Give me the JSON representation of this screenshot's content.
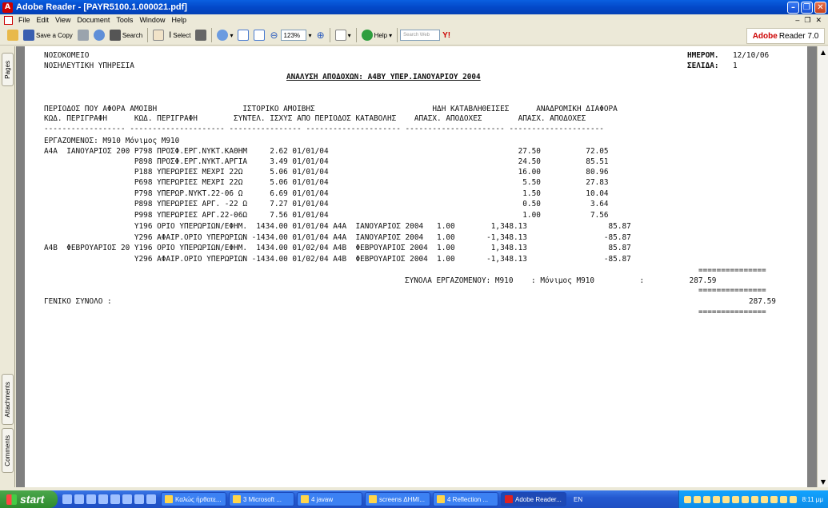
{
  "window": {
    "title": "Adobe Reader - [PAYR5100.1.000021.pdf]"
  },
  "menu": [
    "File",
    "Edit",
    "View",
    "Document",
    "Tools",
    "Window",
    "Help"
  ],
  "toolbar": {
    "save_copy": "Save a Copy",
    "search": "Search",
    "select": "Select",
    "zoom": "123%",
    "help": "Help",
    "search_web_placeholder": "Search Web",
    "brand": "Adobe",
    "brand_product": "Reader 7.0"
  },
  "side_tabs": {
    "pages": "Pages",
    "attachments": "Attachments",
    "comments": "Comments"
  },
  "document": {
    "org1": "ΝΟΣΟΚΟΜΕΙΟ",
    "org2": "ΝΟΣΗΛΕΥΤΙΚΗ ΥΠΗΡΕΣΙΑ",
    "date_label": "ΗΜΕΡΟΜ.",
    "date_value": "12/10/06",
    "page_label": "ΣΕΛΙΔΑ:",
    "page_value": "1",
    "report_title": "ΑΝΑΛΥΣΗ ΑΠΟΔΟΧΩΝ: Α4ΒΥ ΥΠΕΡ.ΙΑΝΟΥΑΡΙΟΥ 2004",
    "header_row1": "ΠΕΡΙΟΔΟΣ ΠΟΥ ΑΦΟΡΑ ΑΜΟΙΒΗ                   ΙΣΤΟΡΙΚΟ ΑΜΟΙΒΗΣ                          ΗΔΗ ΚΑΤΑΒΛΗΘΕΙΣΕΣ      ΑΝΑΔΡΟΜΙΚΗ ΔΙΑΦΟΡΑ",
    "header_row2": "ΚΩΔ. ΠΕΡΙΓΡΑΦΗ      ΚΩΔ. ΠΕΡΙΓΡΑΦΗ        ΣΥΝΤΕΛ. ΙΣΧΥΣ ΑΠΟ ΠΕΡΙΟΔΟΣ ΚΑΤΑΒΟΛΗΣ    ΑΠΑΣΧ. ΑΠΟΔΟΧΕΣ        ΑΠΑΣΧ. ΑΠΟΔΟΧΕΣ",
    "dash_row": "------------------ --------------------- ---------------- --------------------- ---------------------- ---------------------",
    "employee_line": "ΕΡΓΑΖΟΜΕΝΟΣ: Μ910 Μόνιμος Μ910",
    "rows": [
      "Α4Α  ΙΑΝΟΥΑΡΙΟΣ 200 Ρ798 ΠΡΟΣΦ.ΕΡΓ.ΝΥΚΤ.ΚΑΘΗΜ     2.62 01/01/04                                          27.50          72.05",
      "                    Ρ898 ΠΡΟΣΦ.ΕΡΓ.ΝΥΚΤ.ΑΡΓΙΑ     3.49 01/01/04                                          24.50          85.51",
      "                    Ρ188 ΥΠΕΡΩΡΙΕΣ ΜΕΧΡΙ 22Ω      5.06 01/01/04                                          16.00          80.96",
      "                    Ρ698 ΥΠΕΡΩΡΙΕΣ ΜΕΧΡΙ 22Ω      5.06 01/01/04                                           5.50          27.83",
      "                    Ρ798 ΥΠΕΡΩΡ.ΝΥΚΤ.22-06 Ω      6.69 01/01/04                                           1.50          10.04",
      "                    Ρ898 ΥΠΕΡΩΡΙΕΣ ΑΡΓ. -22 Ω     7.27 01/01/04                                           0.50           3.64",
      "                    Ρ998 ΥΠΕΡΩΡΙΕΣ ΑΡΓ.22-06Ω     7.56 01/01/04                                           1.00           7.56",
      "                    Υ196 ΟΡΙΟ ΥΠΕΡΩΡΙΩΝ/ΕΦΗΜ.  1434.00 01/01/04 Α4Α  ΙΑΝΟΥΑΡΙΟΣ 2004   1.00        1,348.13                  85.87",
      "                    Υ296 ΑΦΑΙΡ.ΟΡΙΟ ΥΠΕΡΩΡΙΩΝ -1434.00 01/01/04 Α4Α  ΙΑΝΟΥΑΡΙΟΣ 2004   1.00       -1,348.13                 -85.87",
      "Α4Β  ΦΕΒΡΟΥΑΡΙΟΣ 20 Υ196 ΟΡΙΟ ΥΠΕΡΩΡΙΩΝ/ΕΦΗΜ.  1434.00 01/02/04 Α4Β  ΦΕΒΡΟΥΑΡΙΟΣ 2004  1.00        1,348.13                  85.87",
      "                    Υ296 ΑΦΑΙΡ.ΟΡΙΟ ΥΠΕΡΩΡΙΩΝ -1434.00 01/02/04 Α4Β  ΦΕΒΡΟΥΑΡΙΟΣ 2004  1.00       -1,348.13                 -85.87"
    ],
    "eq_line": "===============",
    "employee_total": "ΣΥΝΟΛΑ ΕΡΓΑΖΟΜΕΝΟΥ: Μ910    : Μόνιμος Μ910          :          287.59",
    "grand_total_label": "ΓΕΝΙΚΟ ΣΥΝΟΛΟ :",
    "grand_total_value": "287.59"
  },
  "taskbar": {
    "start": "start",
    "tasks": [
      "Καλώς ήρθατε...",
      "3 Microsoft ...",
      "4 javaw",
      "screens ΔΗΜΙ...",
      "4 Reflection ...",
      "Adobe Reader..."
    ],
    "lang": "EN",
    "clock": "8:11 μμ"
  }
}
